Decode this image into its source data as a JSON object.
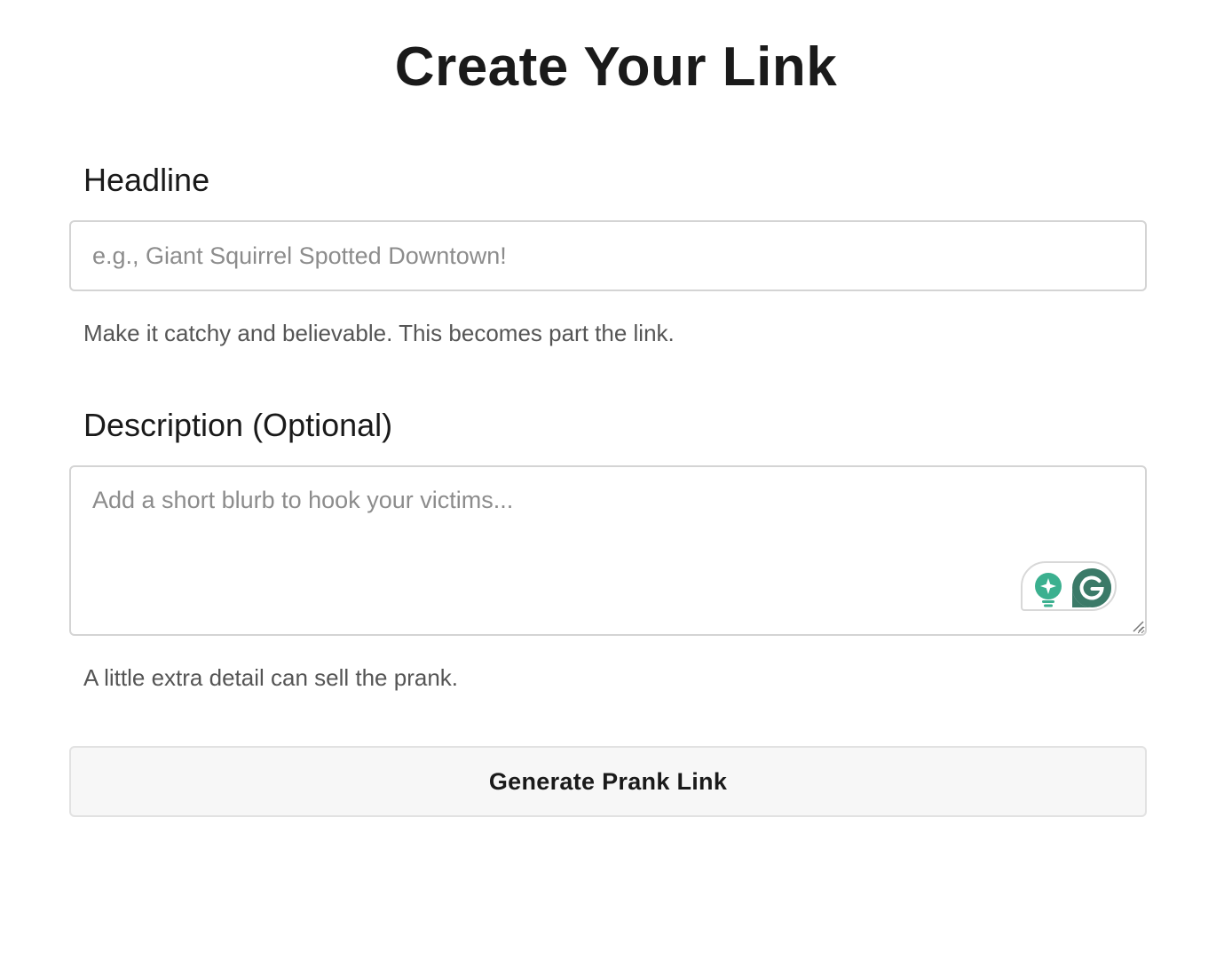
{
  "page": {
    "title": "Create Your Link"
  },
  "headline": {
    "label": "Headline",
    "placeholder": "e.g., Giant Squirrel Spotted Downtown!",
    "value": "",
    "help": "Make it catchy and believable. This becomes part the link."
  },
  "description": {
    "label": "Description (Optional)",
    "placeholder": "Add a short blurb to hook your victims...",
    "value": "",
    "help": "A little extra detail can sell the prank."
  },
  "submit": {
    "label": "Generate Prank Link"
  },
  "grammarly": {
    "icons": [
      "lightbulb-sparkle-icon",
      "grammarly-g-icon"
    ],
    "colors": {
      "bulb": "#3bb08f",
      "logo": "#3b7a68"
    }
  }
}
